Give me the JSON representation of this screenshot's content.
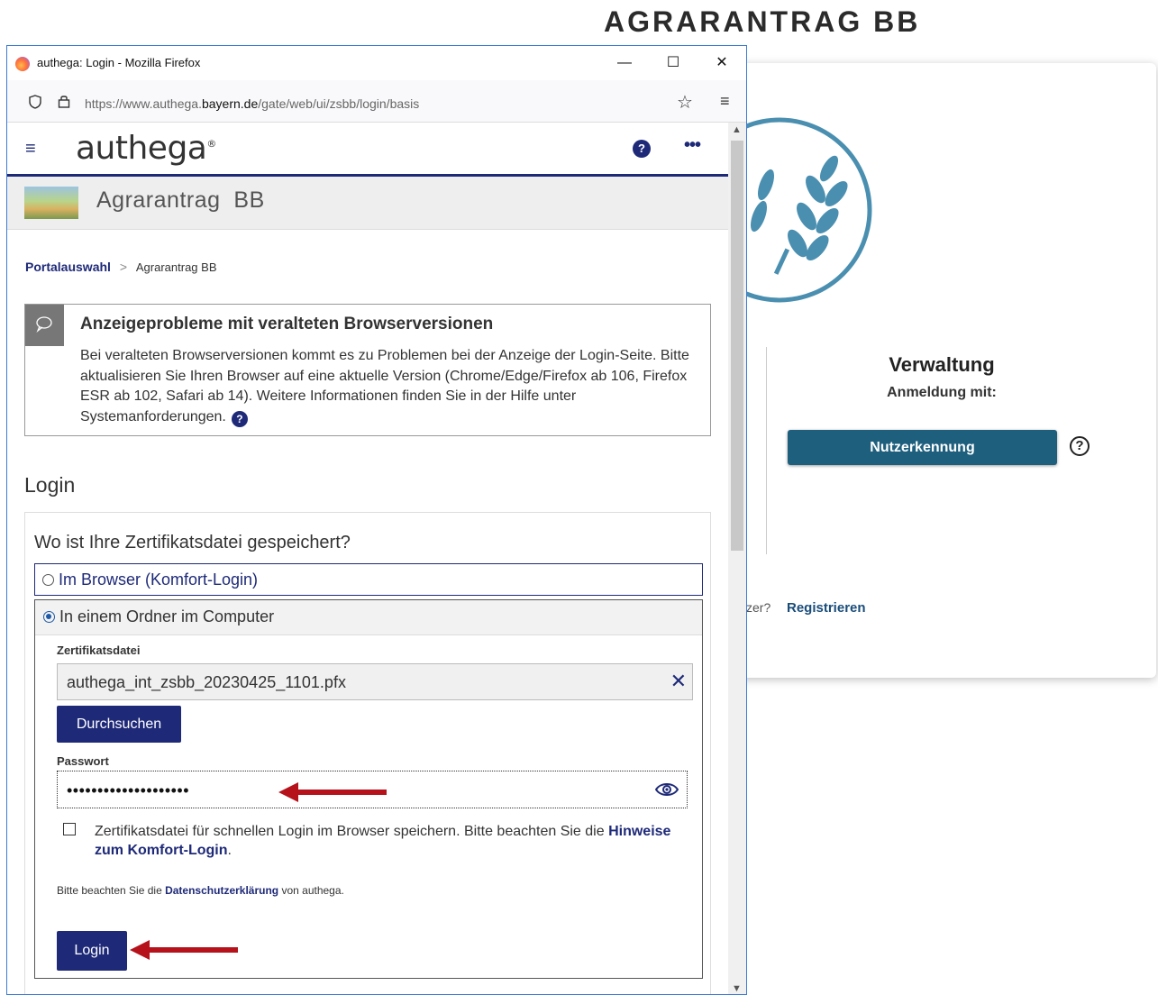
{
  "background": {
    "title": "AGRARANTRAG BB",
    "heading": "Verwaltung",
    "subheading": "Anmeldung mit:",
    "login_button": "Nutzerkennung",
    "help_symbol": "?",
    "register_prefix": "zer?",
    "register_link": "Registrieren"
  },
  "window": {
    "title": "authega: Login - Mozilla Firefox",
    "minimize": "—",
    "maximize": "☐",
    "close": "✕",
    "url_prefix": "https://www.authega.",
    "url_domain": "bayern.de",
    "url_path": "/gate/web/ui/zsbb/login/basis"
  },
  "app": {
    "brand": "authega",
    "brand_mark": "®",
    "portal_name": "Agrarantrag  BB",
    "breadcrumb": {
      "home": "Portalauswahl",
      "separator": ">",
      "current": "Agrarantrag BB"
    },
    "notice": {
      "title": "Anzeigeprobleme mit veralteten Browserversionen",
      "body": "Bei veralteten Browserversionen kommt es zu Problemen bei der Anzeige der Login-Seite. Bitte aktualisieren Sie Ihren Browser auf eine aktuelle Version (Chrome/Edge/Firefox ab 106, Firefox ESR ab 102, Safari ab 14). Weitere Informationen finden Sie in der Hilfe unter Systemanforderungen."
    },
    "login": {
      "title": "Login",
      "question": "Wo ist Ihre Zertifikatsdatei gespeichert?",
      "option_browser": "Im Browser (Komfort-Login)",
      "option_folder": "In einem Ordner im Computer",
      "cert_label": "Zertifikatsdatei",
      "cert_value": "authega_int_zsbb_20230425_1101.pfx",
      "browse_button": "Durchsuchen",
      "password_label": "Passwort",
      "password_value": "••••••••••••••••••••",
      "checkbox_text": "Zertifikatsdatei für schnellen Login im Browser speichern. Bitte beachten Sie die",
      "checkbox_link": "Hinweise zum Komfort-Login",
      "privacy_prefix": "Bitte beachten Sie die",
      "privacy_link": "Datenschutzerklärung",
      "privacy_suffix": "von authega.",
      "login_button": "Login"
    }
  },
  "colors": {
    "primary": "#1e2a78",
    "bg_button": "#1f5f7e",
    "arrow": "#b5121b",
    "wheat": "#4a8fb0"
  }
}
